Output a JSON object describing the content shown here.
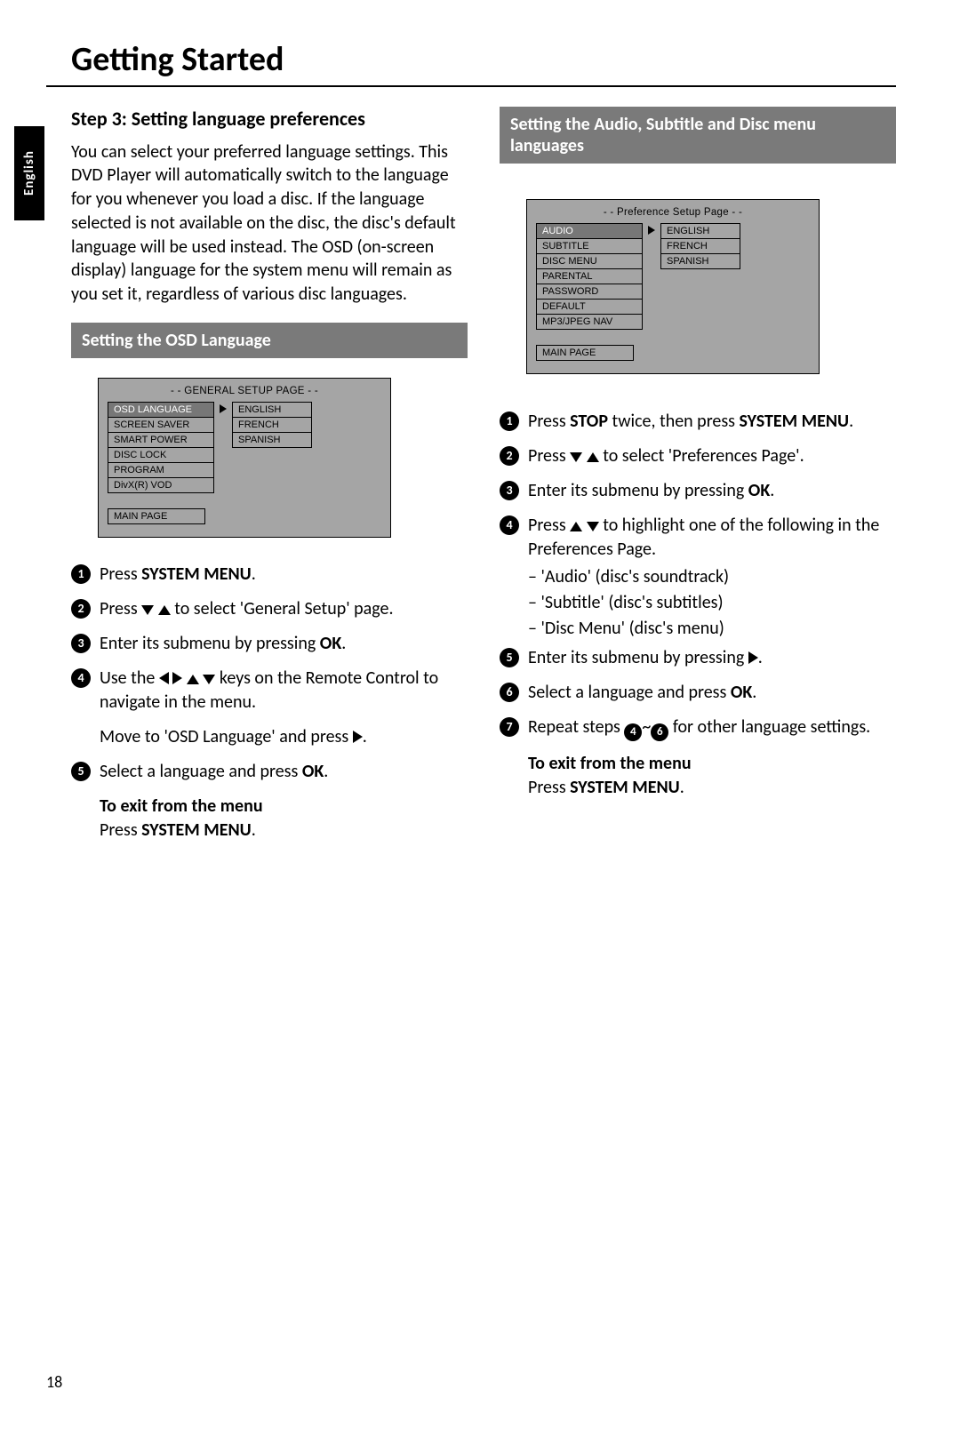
{
  "page_title": "Getting Started",
  "side_tab": "English",
  "page_number": "18",
  "left": {
    "heading": "Step 3:  Setting language preferences",
    "intro": "You can select your preferred language settings. This DVD Player will automatically switch to the language for you whenever you load a disc.  If the language selected is not available on the disc, the disc's default language will be used instead.  The OSD (on-screen display) language for the system menu will remain as you set it, regardless of various disc languages.",
    "bar": "Setting the OSD Language",
    "osd": {
      "title": "- - GENERAL SETUP PAGE - -",
      "items": [
        "OSD LANGUAGE",
        "SCREEN SAVER",
        "SMART POWER",
        "DISC LOCK",
        "PROGRAM",
        "DivX(R) VOD"
      ],
      "langs": [
        "ENGLISH",
        "FRENCH",
        "SPANISH"
      ],
      "main": "MAIN PAGE"
    },
    "steps": {
      "s1_a": "Press ",
      "s1_b": "SYSTEM MENU",
      "s1_c": ".",
      "s2_a": "Press ",
      "s2_b": " to select 'General Setup' page.",
      "s3_a": "Enter its submenu by pressing ",
      "s3_b": "OK",
      "s3_c": ".",
      "s4_a": "Use the ",
      "s4_b": " keys on the Remote Control to navigate in the menu.",
      "s4_sub_a": "Move to 'OSD Language' and press ",
      "s4_sub_b": ".",
      "s5_a": "Select a language and press ",
      "s5_b": "OK",
      "s5_c": "."
    },
    "exit_label": "To exit from the menu",
    "exit_a": "Press ",
    "exit_b": "SYSTEM MENU",
    "exit_c": "."
  },
  "right": {
    "bar": "Setting the Audio, Subtitle and Disc menu languages",
    "osd": {
      "title": "- - Preference Setup Page - -",
      "items": [
        "AUDIO",
        "SUBTITLE",
        "DISC MENU",
        "PARENTAL",
        "PASSWORD",
        "DEFAULT",
        "MP3/JPEG NAV"
      ],
      "langs": [
        "ENGLISH",
        "FRENCH",
        "SPANISH"
      ],
      "main": "MAIN PAGE"
    },
    "steps": {
      "s1_a": "Press ",
      "s1_b": "STOP",
      "s1_c": " twice, then press ",
      "s1_d": "SYSTEM MENU",
      "s1_e": ".",
      "s2_a": "Press ",
      "s2_b": " to select 'Preferences Page'.",
      "s3_a": "Enter its submenu by pressing ",
      "s3_b": "OK",
      "s3_c": ".",
      "s4_a": "Press ",
      "s4_b": " to highlight one of the following in the Preferences Page.",
      "s4_opt1": "–  'Audio' (disc's soundtrack)",
      "s4_opt2": "–  'Subtitle' (disc's subtitles)",
      "s4_opt3": "–  'Disc Menu' (disc's menu)",
      "s5_a": "Enter its submenu by pressing ",
      "s5_b": ".",
      "s6_a": "Select a language and press ",
      "s6_b": "OK",
      "s6_c": ".",
      "s7_a": "Repeat steps ",
      "s7_b": "~",
      "s7_c": " for other language settings.",
      "s7_ref1": "4",
      "s7_ref2": "6"
    },
    "exit_label": "To exit from the menu",
    "exit_a": "Press ",
    "exit_b": "SYSTEM MENU",
    "exit_c": "."
  }
}
